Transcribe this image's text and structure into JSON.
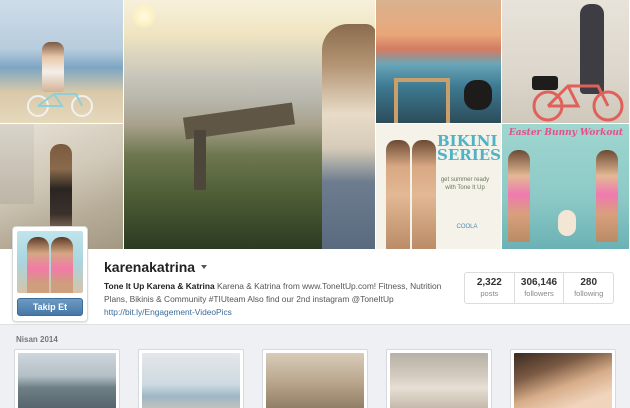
{
  "profile": {
    "username": "karenakatrina",
    "follow_label": "Takip Et",
    "bio": {
      "name": "Tone It Up",
      "heart": "",
      "display_name": "Karena & Katrina",
      "text": "Karena & Katrina from www.ToneItUp.com! Fitness, Nutrition Plans, Bikinis & Community #TIUteam Also find our 2nd instagram @ToneItUp",
      "emoji": "",
      "link": "http://bit.ly/Engagement-VideoPics"
    },
    "stats": [
      {
        "value": "2,322",
        "label": "posts"
      },
      {
        "value": "306,146",
        "label": "followers"
      },
      {
        "value": "280",
        "label": "following"
      }
    ]
  },
  "cover": {
    "bikini_tile": {
      "title": "BIKINI SERIES",
      "subtitle": "get summer ready with Tone It Up",
      "brand": "COOLA"
    },
    "easter_tile": {
      "title": "Easter Bunny Workout"
    }
  },
  "feed": {
    "month": "Nisan 2014"
  },
  "colors": {
    "follow_button": "#4677a6",
    "link": "#3b6a9a",
    "feed_bg": "#eef0f3"
  }
}
